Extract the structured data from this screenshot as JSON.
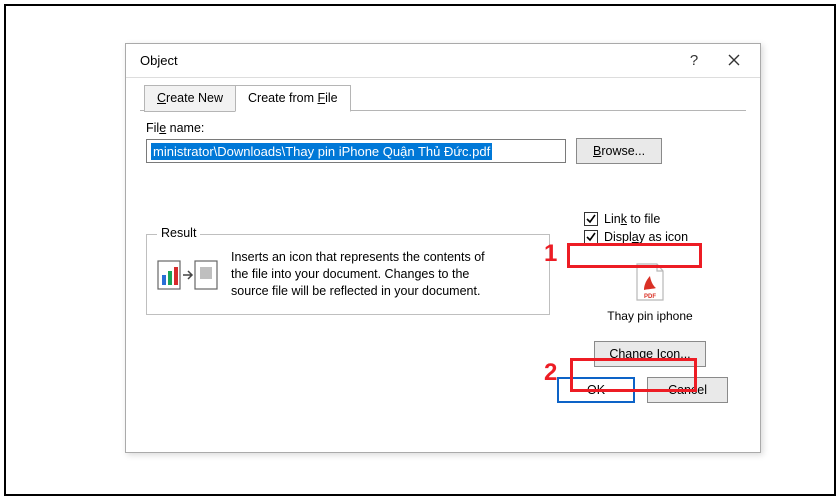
{
  "dialog": {
    "title": "Object",
    "tabs": {
      "create_new": "Create New",
      "create_from_file": "Create from File"
    },
    "file_section": {
      "label": "File name:",
      "value": "ministrator\\Downloads\\Thay pin iPhone Quận Thủ Đức.pdf",
      "browse_label": "Browse..."
    },
    "options": {
      "link_to_file": "Link to file",
      "display_as_icon": "Display as icon"
    },
    "result": {
      "legend": "Result",
      "text": "Inserts an icon that represents the contents of the file into your document. Changes to the source file will be reflected in your document."
    },
    "preview": {
      "caption": "Thay pin iphone"
    },
    "change_icon_label": "Change Icon...",
    "buttons": {
      "ok": "OK",
      "cancel": "Cancel"
    }
  },
  "annotations": {
    "one": "1",
    "two": "2"
  }
}
